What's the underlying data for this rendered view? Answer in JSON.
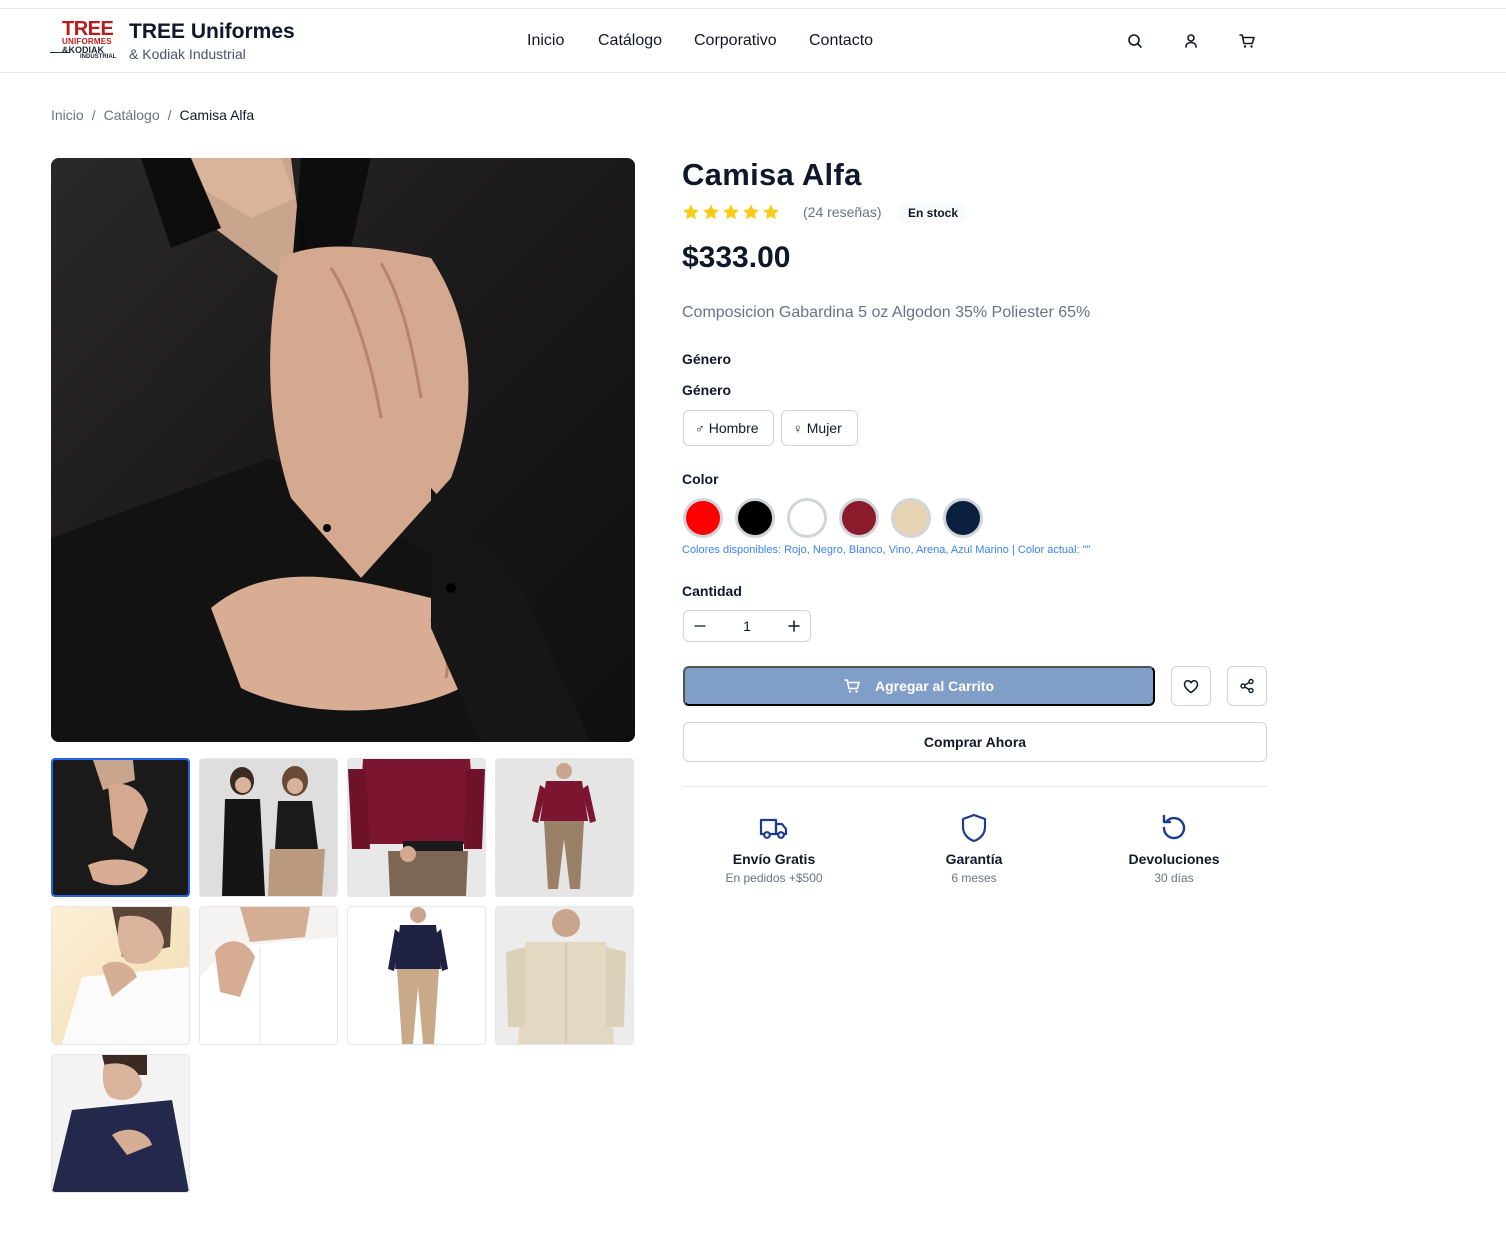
{
  "header": {
    "logo": {
      "line1": "TREE",
      "line2": "UNIFORMES",
      "line3": "&KODIAK",
      "line4": "INDUSTRIAL"
    },
    "brand_title": "TREE Uniformes",
    "brand_subtitle": "& Kodiak Industrial",
    "nav": [
      "Inicio",
      "Catálogo",
      "Corporativo",
      "Contacto"
    ],
    "icons": [
      "search-icon",
      "user-icon",
      "cart-icon"
    ]
  },
  "breadcrumb": {
    "items": [
      "Inicio",
      "Catálogo"
    ],
    "current": "Camisa Alfa"
  },
  "gallery": {
    "thumbnails": [
      "black-shirt-closeup",
      "two-women-black-shirts",
      "wine-shirt-torso",
      "wine-shirt-full",
      "white-shirt-portrait",
      "white-shirt-closeup",
      "navy-shirt-full",
      "beige-shirt",
      "navy-shirt-portrait"
    ],
    "active_index": 0
  },
  "product": {
    "title": "Camisa Alfa",
    "rating": 5,
    "reviews": "(24 reseñas)",
    "stock_badge": "En stock",
    "price": "$333.00",
    "description": "Composicion Gabardina 5 oz Algodon 35% Poliester 65%",
    "gender_label_1": "Género",
    "gender_label_2": "Género",
    "genders": [
      {
        "symbol": "♂",
        "label": "Hombre"
      },
      {
        "symbol": "♀",
        "label": "Mujer"
      }
    ],
    "color_label": "Color",
    "colors": [
      {
        "name": "Rojo",
        "hex": "#ff0000"
      },
      {
        "name": "Negro",
        "hex": "#000000"
      },
      {
        "name": "Blanco",
        "hex": "#ffffff"
      },
      {
        "name": "Vino",
        "hex": "#8b1a2b"
      },
      {
        "name": "Arena",
        "hex": "#e6d3b1"
      },
      {
        "name": "Azul Marino",
        "hex": "#0b1f3f"
      }
    ],
    "colors_note": "Colores disponibles: Rojo, Negro, Blanco, Vino, Arena, Azul Marino | Color actual: \"\"",
    "quantity_label": "Cantidad",
    "quantity": "1",
    "add_to_cart": "Agregar al Carrito",
    "buy_now": "Comprar Ahora"
  },
  "features": [
    {
      "icon": "truck-icon",
      "title": "Envío Gratis",
      "subtitle": "En pedidos +$500"
    },
    {
      "icon": "shield-icon",
      "title": "Garantía",
      "subtitle": "6 meses"
    },
    {
      "icon": "return-icon",
      "title": "Devoluciones",
      "subtitle": "30 días"
    }
  ],
  "colors_ui": {
    "primary_disabled": "#819ec9",
    "accent": "#1e3a8a",
    "star": "#facc15",
    "active_border": "#2563eb"
  }
}
